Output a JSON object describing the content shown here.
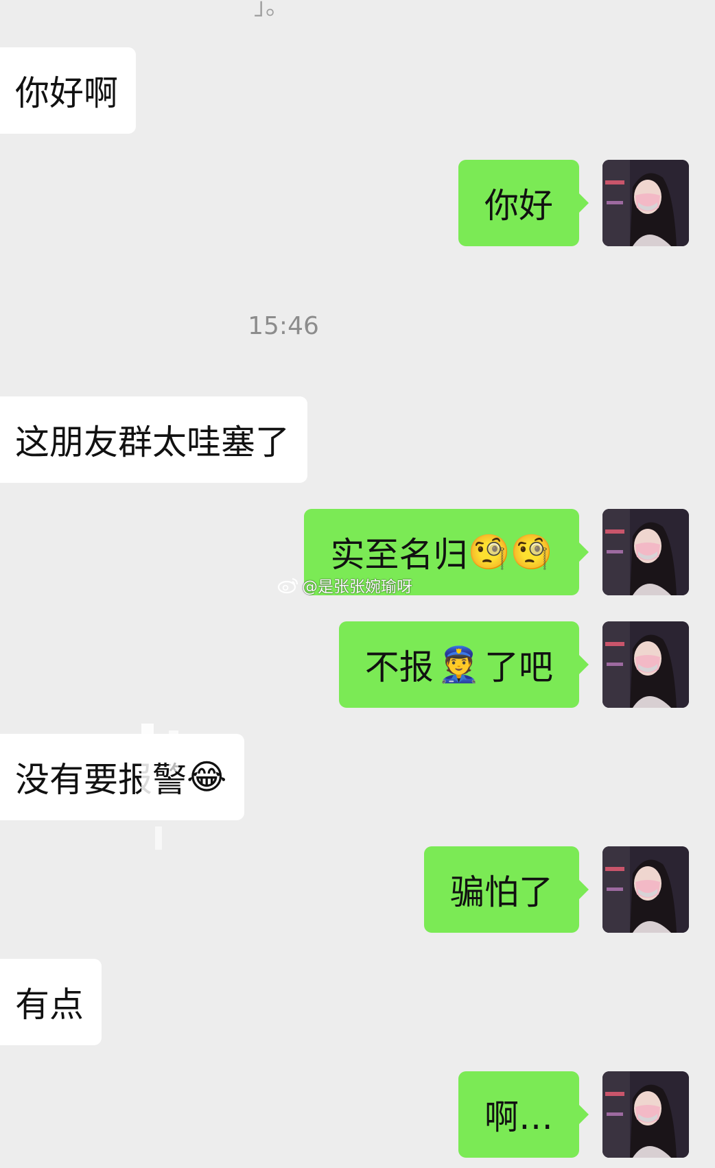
{
  "messages": [
    {
      "side": "left",
      "text": "你好啊"
    },
    {
      "side": "right",
      "text": "你好"
    },
    {
      "timestamp": "15:46"
    },
    {
      "side": "left",
      "text": "这朋友群太哇塞了"
    },
    {
      "side": "right",
      "text": "实至名归",
      "emoji": "🧐🧐"
    },
    {
      "side": "right",
      "text_before": "不报",
      "emoji": "👮",
      "text_after": "了吧"
    },
    {
      "side": "left",
      "text": "没有要报警",
      "emoji": "😂"
    },
    {
      "side": "right",
      "text": "骗怕了"
    },
    {
      "side": "left",
      "text": "有点"
    },
    {
      "side": "right",
      "text": "啊…"
    }
  ],
  "watermark": "@是张张婉瑜呀",
  "avatar": {
    "icon": "user-avatar-icon"
  },
  "colors": {
    "background": "#ededed",
    "sent_bubble": "#7bea55",
    "received_bubble": "#ffffff",
    "timestamp": "#8c8c8c"
  }
}
